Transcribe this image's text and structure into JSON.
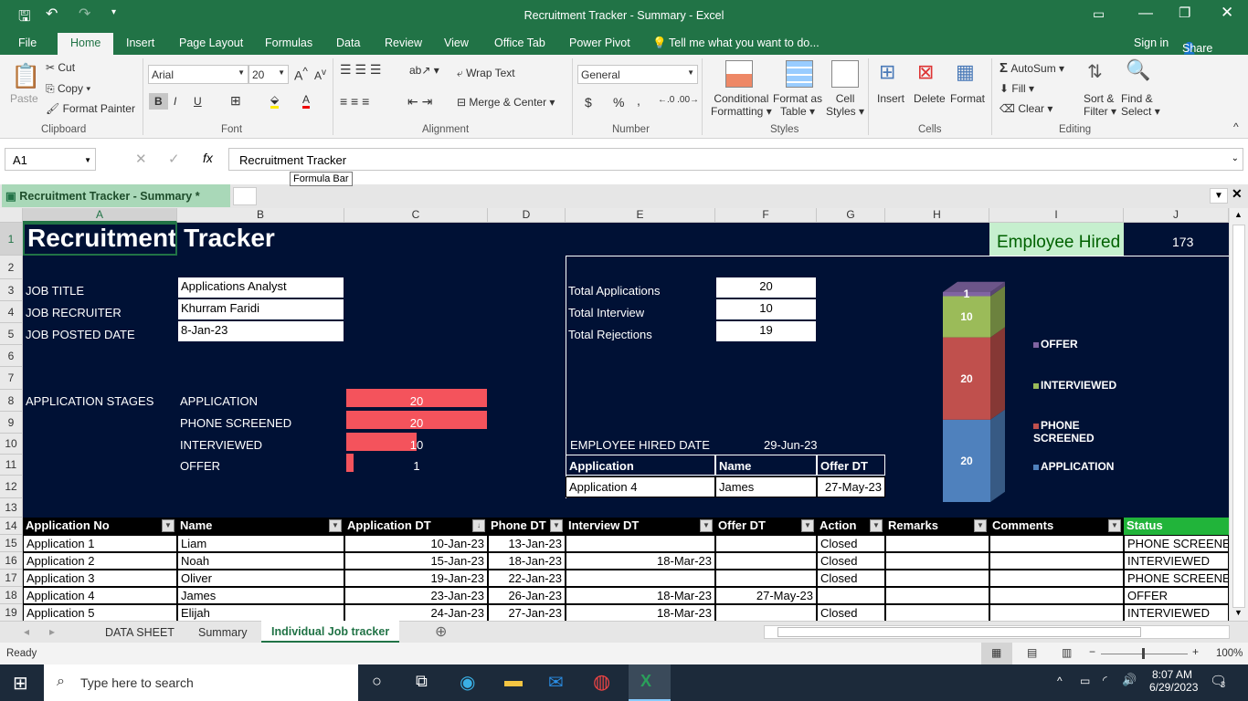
{
  "window": {
    "title": "Recruitment Tracker - Summary - Excel",
    "sign_in": "Sign in",
    "share": "Share"
  },
  "menu": [
    "File",
    "Home",
    "Insert",
    "Page Layout",
    "Formulas",
    "Data",
    "Review",
    "View",
    "Office Tab",
    "Power Pivot"
  ],
  "tell_me": "Tell me what you want to do...",
  "ribbon": {
    "clipboard": {
      "paste": "Paste",
      "cut": "Cut",
      "copy": "Copy",
      "format_painter": "Format Painter",
      "label": "Clipboard"
    },
    "font": {
      "name": "Arial",
      "size": "20",
      "label": "Font",
      "bold": "B",
      "italic": "I",
      "underline": "U"
    },
    "alignment": {
      "wrap": "Wrap Text",
      "merge": "Merge & Center",
      "label": "Alignment"
    },
    "number": {
      "format": "General",
      "label": "Number",
      "currency": "$",
      "percent": "%",
      "comma": ","
    },
    "styles": {
      "conditional": "Conditional",
      "conditional2": "Formatting",
      "format_as": "Format as",
      "format_as2": "Table",
      "cell": "Cell",
      "cell2": "Styles",
      "label": "Styles"
    },
    "cells": {
      "insert": "Insert",
      "delete": "Delete",
      "format": "Format",
      "label": "Cells"
    },
    "editing": {
      "autosum": "AutoSum",
      "fill": "Fill",
      "clear": "Clear",
      "sort": "Sort &",
      "sort2": "Filter",
      "find": "Find &",
      "find2": "Select",
      "label": "Editing"
    }
  },
  "formula_bar": {
    "name_box": "A1",
    "fx": "fx",
    "value": "Recruitment Tracker",
    "tooltip": "Formula Bar"
  },
  "workbook_tab": "Recruitment Tracker - Summary *",
  "columns": [
    "A",
    "B",
    "C",
    "D",
    "E",
    "F",
    "G",
    "H",
    "I",
    "J"
  ],
  "rows": [
    "1",
    "2",
    "3",
    "4",
    "5",
    "6",
    "7",
    "8",
    "9",
    "10",
    "11",
    "12",
    "13",
    "14",
    "15",
    "16",
    "17",
    "18",
    "19"
  ],
  "sheet": {
    "title": "Recruitment Tracker",
    "employee_hired_label": "Employee Hired",
    "employee_hired_value": "173",
    "job_title_label": "JOB TITLE",
    "job_title": "Applications Analyst",
    "recruiter_label": "JOB RECRUITER",
    "recruiter": "Khurram Faridi",
    "posted_label": "JOB POSTED DATE",
    "posted": "8-Jan-23",
    "total_applications_label": "Total Applications",
    "total_applications": "20",
    "total_interview_label": "Total Interview",
    "total_interview": "10",
    "total_rejections_label": "Total Rejections",
    "total_rejections": "19",
    "stages_label": "APPLICATION STAGES",
    "stages": [
      {
        "name": "APPLICATION",
        "value": 20
      },
      {
        "name": "PHONE SCREENED",
        "value": 20
      },
      {
        "name": "INTERVIEWED",
        "value": 10
      },
      {
        "name": "OFFER",
        "value": 1
      }
    ],
    "stage_max": 20,
    "hired_date_label": "EMPLOYEE HIRED DATE",
    "hired_date": "29-Jun-23",
    "hired_table": {
      "headers": [
        "Application",
        "Name",
        "Offer DT"
      ],
      "row": [
        "Application 4",
        "James",
        "27-May-23"
      ]
    }
  },
  "chart_data": {
    "type": "bar",
    "stacked": true,
    "categories": [
      ""
    ],
    "series": [
      {
        "name": "APPLICATION",
        "values": [
          20
        ],
        "color": "#4f81bd"
      },
      {
        "name": "PHONE SCREENED",
        "values": [
          20
        ],
        "color": "#c0504d"
      },
      {
        "name": "INTERVIEWED",
        "values": [
          10
        ],
        "color": "#9bbb59"
      },
      {
        "name": "OFFER",
        "values": [
          1
        ],
        "color": "#8064a2"
      }
    ],
    "legend": "right"
  },
  "table": {
    "headers": [
      "Application No",
      "Name",
      "Application DT",
      "Phone DT",
      "Interview DT",
      "Offer DT",
      "Action",
      "Remarks",
      "Comments",
      "Status"
    ],
    "rows": [
      [
        "Application 1",
        "Liam",
        "10-Jan-23",
        "13-Jan-23",
        "",
        "",
        "Closed",
        "",
        "",
        "PHONE SCREENED"
      ],
      [
        "Application 2",
        "Noah",
        "15-Jan-23",
        "18-Jan-23",
        "18-Mar-23",
        "",
        "Closed",
        "",
        "",
        "INTERVIEWED"
      ],
      [
        "Application 3",
        "Oliver",
        "19-Jan-23",
        "22-Jan-23",
        "",
        "",
        "Closed",
        "",
        "",
        "PHONE SCREENED"
      ],
      [
        "Application 4",
        "James",
        "23-Jan-23",
        "26-Jan-23",
        "18-Mar-23",
        "27-May-23",
        "",
        "",
        "",
        "OFFER"
      ],
      [
        "Application 5",
        "Elijah",
        "24-Jan-23",
        "27-Jan-23",
        "18-Mar-23",
        "",
        "Closed",
        "",
        "",
        "INTERVIEWED"
      ]
    ]
  },
  "sheet_tabs": [
    "DATA SHEET",
    "Summary",
    "Individual Job tracker"
  ],
  "active_sheet": "Individual Job tracker",
  "status": {
    "ready": "Ready",
    "zoom": "100%"
  },
  "taskbar": {
    "search": "Type here to search",
    "time": "8:07 AM",
    "date": "6/29/2023",
    "notifications": "3"
  },
  "colors": {
    "excel_green": "#217346",
    "navy": "#001135",
    "bar": "#f4535c",
    "status_header": "#21b43a"
  }
}
